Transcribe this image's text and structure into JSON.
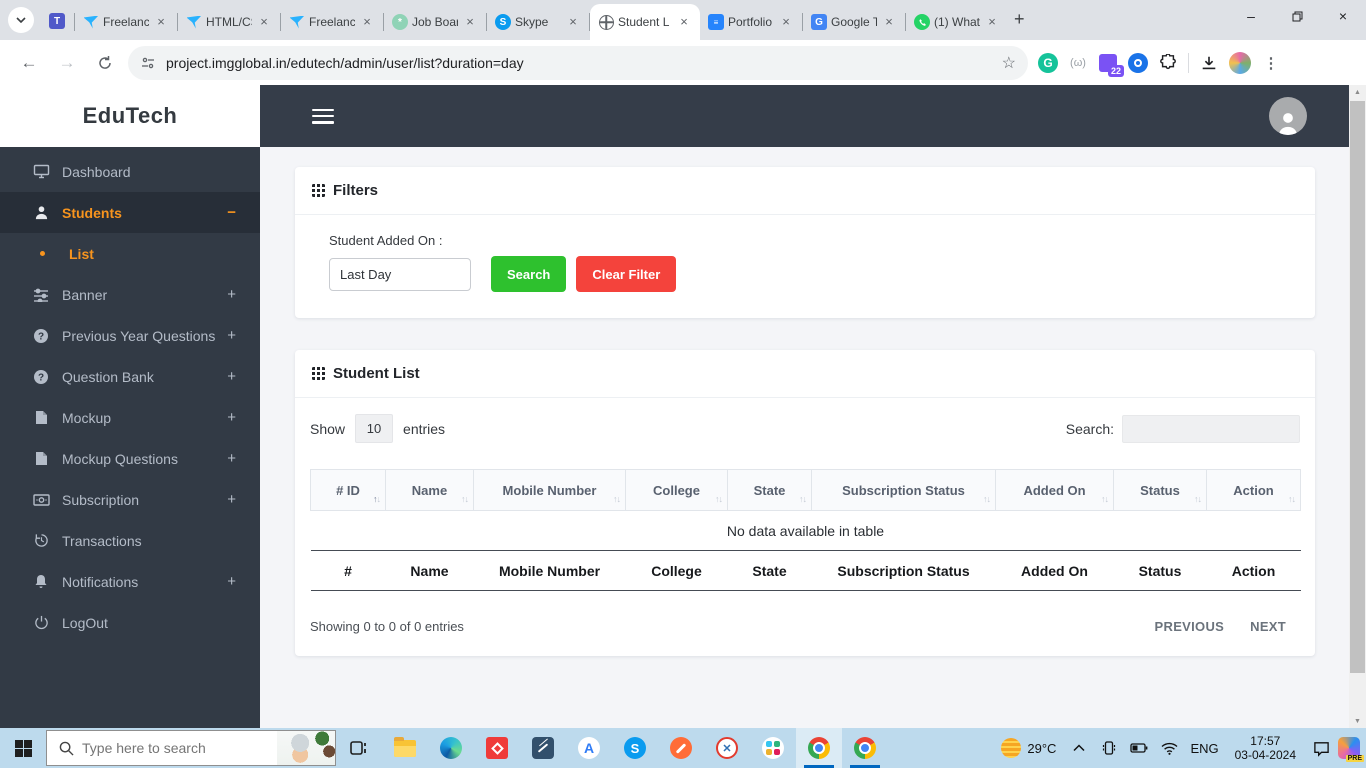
{
  "browser": {
    "tabs": [
      {
        "label": "Freelance",
        "icon": "freelancer"
      },
      {
        "label": "HTML/CS",
        "icon": "freelancer"
      },
      {
        "label": "Freelance",
        "icon": "freelancer"
      },
      {
        "label": "Job Boar",
        "icon": "chatgpt"
      },
      {
        "label": "Skype",
        "icon": "skype"
      },
      {
        "label": "Student L",
        "icon": "globe",
        "active": true
      },
      {
        "label": "Portfolio",
        "icon": "google-docs"
      },
      {
        "label": "Google T",
        "icon": "google-translate"
      },
      {
        "label": "(1) What",
        "icon": "whatsapp"
      }
    ],
    "url": "project.imgglobal.in/edutech/admin/user/list?duration=day",
    "extension_badge": "22"
  },
  "sidebar": {
    "logo": "EduTech",
    "items": [
      {
        "label": "Dashboard"
      },
      {
        "label": "Students",
        "expand": "−",
        "active": true
      },
      {
        "label": "List",
        "sub": true
      },
      {
        "label": "Banner",
        "expand": "+"
      },
      {
        "label": "Previous Year Questions",
        "expand": "+"
      },
      {
        "label": "Question Bank",
        "expand": "+"
      },
      {
        "label": "Mockup",
        "expand": "+"
      },
      {
        "label": "Mockup Questions",
        "expand": "+"
      },
      {
        "label": "Subscription",
        "expand": "+"
      },
      {
        "label": "Transactions"
      },
      {
        "label": "Notifications",
        "expand": "+"
      },
      {
        "label": "LogOut"
      }
    ]
  },
  "filters": {
    "title": "Filters",
    "field_label": "Student Added On :",
    "field_value": "Last Day",
    "search_label": "Search",
    "clear_label": "Clear Filter",
    "search_color": "#2ec12e",
    "clear_color": "#f4433c"
  },
  "student_list": {
    "title": "Student List",
    "show_label": "Show",
    "page_size": "10",
    "entries_label": "entries",
    "search_label": "Search:",
    "columns": [
      "# ID",
      "Name",
      "Mobile Number",
      "College",
      "State",
      "Subscription Status",
      "Added On",
      "Status",
      "Action"
    ],
    "footer_columns": [
      "#",
      "Name",
      "Mobile Number",
      "College",
      "State",
      "Subscription Status",
      "Added On",
      "Status",
      "Action"
    ],
    "empty_text": "No data available in table",
    "summary": "Showing 0 to 0 of 0 entries",
    "prev_label": "PREVIOUS",
    "next_label": "NEXT"
  },
  "taskbar": {
    "search_placeholder": "Type here to search",
    "temperature": "29°C",
    "language": "ENG",
    "time": "17:57",
    "date": "03-04-2024",
    "copilot_badge": "PRE"
  }
}
